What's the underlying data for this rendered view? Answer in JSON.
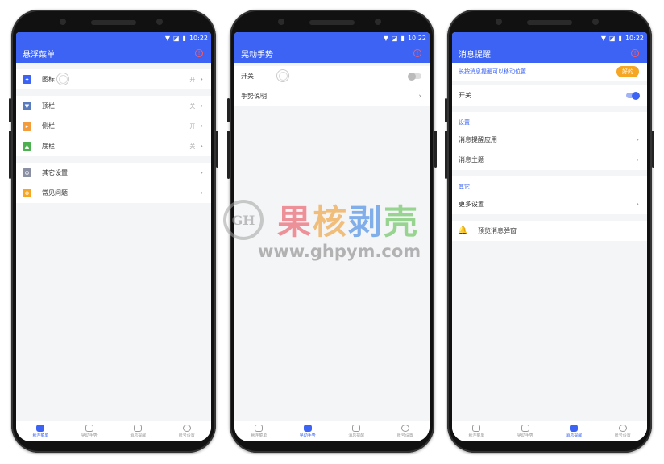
{
  "status": {
    "time": "10:22",
    "wifi": "▼",
    "signal": "◪",
    "battery": "▮"
  },
  "screens": [
    {
      "title": "悬浮菜单",
      "groups": [
        [
          {
            "label": "图标",
            "value": "开",
            "color": "#3c63f3",
            "icon": "pin-icon"
          }
        ],
        [
          {
            "label": "顶栏",
            "value": "关",
            "color": "#5b7bbf",
            "icon": "top-bar-icon"
          },
          {
            "label": "侧栏",
            "value": "开",
            "color": "#f39c3c",
            "icon": "side-bar-icon"
          },
          {
            "label": "底栏",
            "value": "关",
            "color": "#4caf50",
            "icon": "bottom-bar-icon"
          }
        ],
        [
          {
            "label": "其它设置",
            "value": "",
            "color": "#8a8fa3",
            "icon": "gear-icon"
          },
          {
            "label": "常见问题",
            "value": "",
            "color": "#f5a623",
            "icon": "help-icon"
          }
        ]
      ]
    },
    {
      "title": "晃动手势",
      "rows": [
        {
          "label": "开关"
        },
        {
          "label": "手势说明"
        }
      ]
    },
    {
      "title": "消息提醒",
      "tip": "长按消息提醒可以移动位置",
      "tip_button": "好的",
      "switch_label": "开关",
      "section_settings": "设置",
      "settings_rows": [
        "消息提醒应用",
        "消息主题"
      ],
      "section_other": "其它",
      "other_rows": [
        "更多设置"
      ],
      "preview": "预览消息弹窗"
    }
  ],
  "nav": [
    "悬浮菜单",
    "晃动手势",
    "消息提醒",
    "账号设置"
  ],
  "watermark": {
    "cn": [
      "果",
      "核",
      "剥",
      "壳"
    ],
    "url": "www.ghpym.com"
  }
}
